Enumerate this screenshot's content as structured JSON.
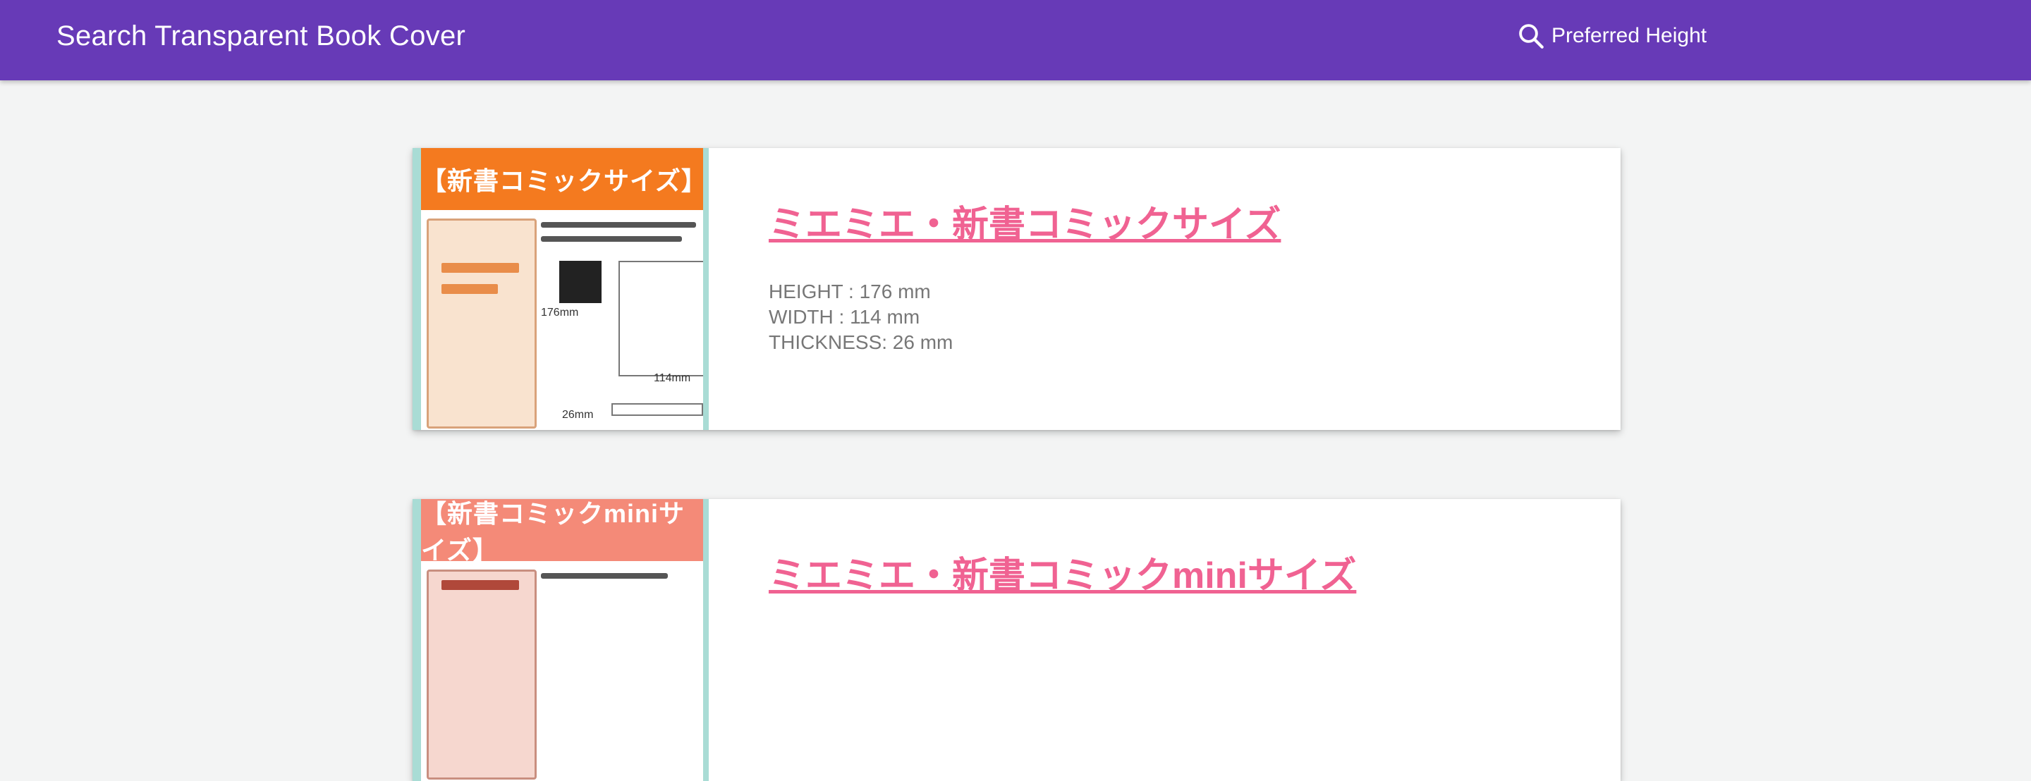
{
  "appbar": {
    "title": "Search Transparent Book Cover",
    "search_label": "Preferred Height",
    "icon": "search-icon"
  },
  "results": [
    {
      "banner": "【新書コミックサイズ】",
      "title": "ミエミエ・新書コミックサイズ",
      "specs": [
        "HEIGHT : 176 mm",
        "WIDTH : 114 mm",
        "THICKNESS: 26 mm"
      ],
      "thumb_dims": {
        "height": "176mm",
        "width": "114mm",
        "thickness": "26mm"
      }
    },
    {
      "banner": "【新書コミックminiサイズ】",
      "title": "ミエミエ・新書コミックminiサイズ"
    }
  ],
  "colors": {
    "appbar": "#673ab7",
    "link": "#f06292",
    "banner_1": "#f47a1f",
    "banner_2": "#f48a78"
  }
}
